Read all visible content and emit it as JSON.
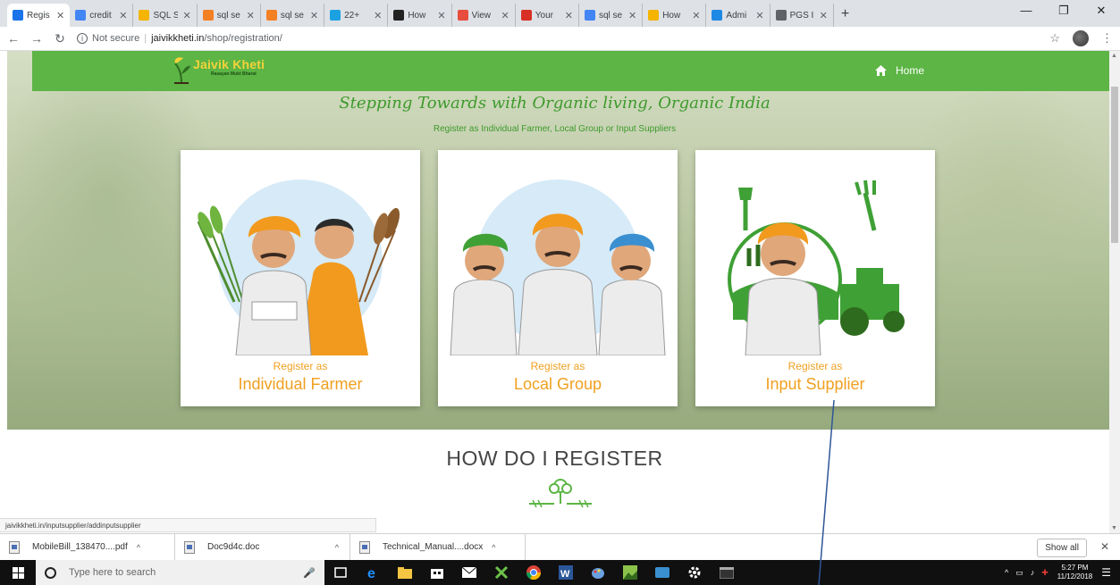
{
  "browser": {
    "tabs": [
      {
        "label": "Regis",
        "color": "#1a73e8",
        "active": true
      },
      {
        "label": "credit",
        "color": "#4285f4"
      },
      {
        "label": "SQL S",
        "color": "#f4b400"
      },
      {
        "label": "sql se",
        "color": "#f48024"
      },
      {
        "label": "sql se",
        "color": "#f48024"
      },
      {
        "label": "22+",
        "color": "#1ba1e2"
      },
      {
        "label": "How",
        "color": "#222222"
      },
      {
        "label": "View",
        "color": "#e74c3c"
      },
      {
        "label": "Your",
        "color": "#d93025"
      },
      {
        "label": "sql se",
        "color": "#4285f4"
      },
      {
        "label": "How",
        "color": "#f4b400"
      },
      {
        "label": "Admi",
        "color": "#1e88e5"
      },
      {
        "label": "PGS I",
        "color": "#5f6368"
      }
    ],
    "url_prefix": "Not secure",
    "url_host": "jaivikkheti.in",
    "url_path": "/shop/registration/"
  },
  "site": {
    "logo_title": "Jaivik Kheti",
    "logo_subtitle": "Rasayan Mukt Bharat",
    "home_label": "Home",
    "tagline": "Stepping Towards with Organic living, Organic India",
    "subtitle": "Register as Individual Farmer, Local Group or Input Suppliers",
    "cards": [
      {
        "pre": "Register as",
        "main": "Individual Farmer"
      },
      {
        "pre": "Register as",
        "main": "Local Group"
      },
      {
        "pre": "Register as",
        "main": "Input Supplier"
      }
    ],
    "howto_title": "HOW DO I REGISTER",
    "status_url": "jaivikkheti.in/inputsupplier/addinputsupplier"
  },
  "downloads": {
    "items": [
      {
        "name": "MobileBill_138470....pdf"
      },
      {
        "name": "Doc9d4c.doc"
      },
      {
        "name": "Technical_Manual....docx"
      }
    ],
    "show_all": "Show all"
  },
  "taskbar": {
    "search_placeholder": "Type here to search",
    "time": "5:27 PM",
    "date": "11/12/2018"
  },
  "colors": {
    "nav_green": "#5cb545",
    "accent_orange": "#f0a020",
    "tagline_green": "#3d9a2c"
  }
}
